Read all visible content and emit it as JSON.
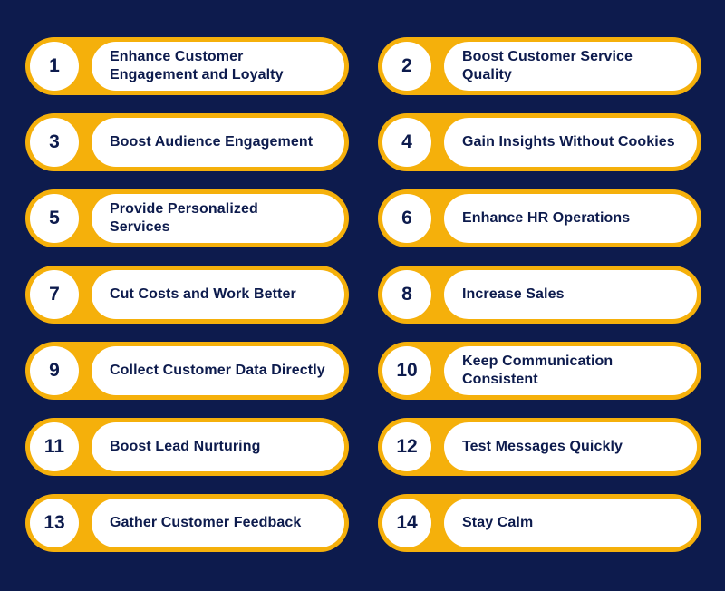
{
  "colors": {
    "background": "#0d1b4d",
    "accent": "#f5b00b",
    "card": "#ffffff",
    "text": "#0d1b4d"
  },
  "items": [
    {
      "number": "1",
      "label": "Enhance Customer Engagement and Loyalty"
    },
    {
      "number": "2",
      "label": "Boost Customer Service Quality"
    },
    {
      "number": "3",
      "label": "Boost Audience Engagement"
    },
    {
      "number": "4",
      "label": "Gain Insights Without Cookies"
    },
    {
      "number": "5",
      "label": "Provide Personalized Services"
    },
    {
      "number": "6",
      "label": "Enhance HR Operations"
    },
    {
      "number": "7",
      "label": "Cut Costs and Work Better"
    },
    {
      "number": "8",
      "label": "Increase Sales"
    },
    {
      "number": "9",
      "label": "Collect Customer Data Directly"
    },
    {
      "number": "10",
      "label": "Keep Communication Consistent"
    },
    {
      "number": "11",
      "label": "Boost Lead Nurturing"
    },
    {
      "number": "12",
      "label": "Test Messages Quickly"
    },
    {
      "number": "13",
      "label": "Gather Customer Feedback"
    },
    {
      "number": "14",
      "label": "Stay Calm"
    }
  ]
}
